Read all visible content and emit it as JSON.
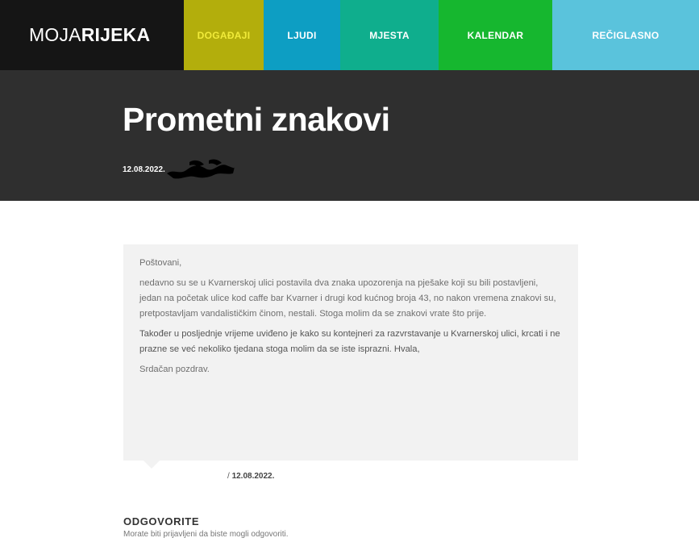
{
  "brand": {
    "light": "MOJA",
    "bold": "RIJEKA"
  },
  "nav": {
    "items": [
      {
        "label": "DOGAĐAJI"
      },
      {
        "label": "LJUDI"
      },
      {
        "label": "MJESTA"
      },
      {
        "label": "KALENDAR"
      },
      {
        "label": "REČIGLASNO"
      }
    ]
  },
  "article": {
    "title": "Prometni znakovi",
    "date": "12.08.2022."
  },
  "comment": {
    "paragraphs": [
      "Poštovani,",
      "nedavno su se u Kvarnerskoj ulici postavila dva znaka upozorenja na pješake koji su bili postavljeni, jedan na početak ulice kod caffe bar Kvarner i drugi kod kućnog broja 43, no nakon vremena znakovi su, pretpostavljam vandalističkim činom, nestali. Stoga molim da se znakovi vrate što prije.",
      "Također u posljednje vrijeme uviđeno je kako su kontejneri za razvrstavanje u Kvarnerskoj ulici, krcati i ne prazne se već nekoliko tjedana stoga molim da se iste isprazni. Hvala,",
      "Srdačan pozdrav."
    ],
    "separator": "/",
    "date": "12.08.2022."
  },
  "reply": {
    "heading": "ODGOVORITE",
    "note": "Morate biti prijavljeni da biste mogli odgovoriti."
  },
  "colors": {
    "brand_bg": "#151515",
    "nav_dogadaji": "#b3ae0c",
    "nav_ljudi": "#0d9ec3",
    "nav_mjesta": "#0fae8d",
    "nav_kalendar": "#16b72f",
    "nav_reciglasno": "#5ac3dc",
    "hero_bg": "#2f2f2f",
    "card_bg": "#f2f2f2"
  }
}
